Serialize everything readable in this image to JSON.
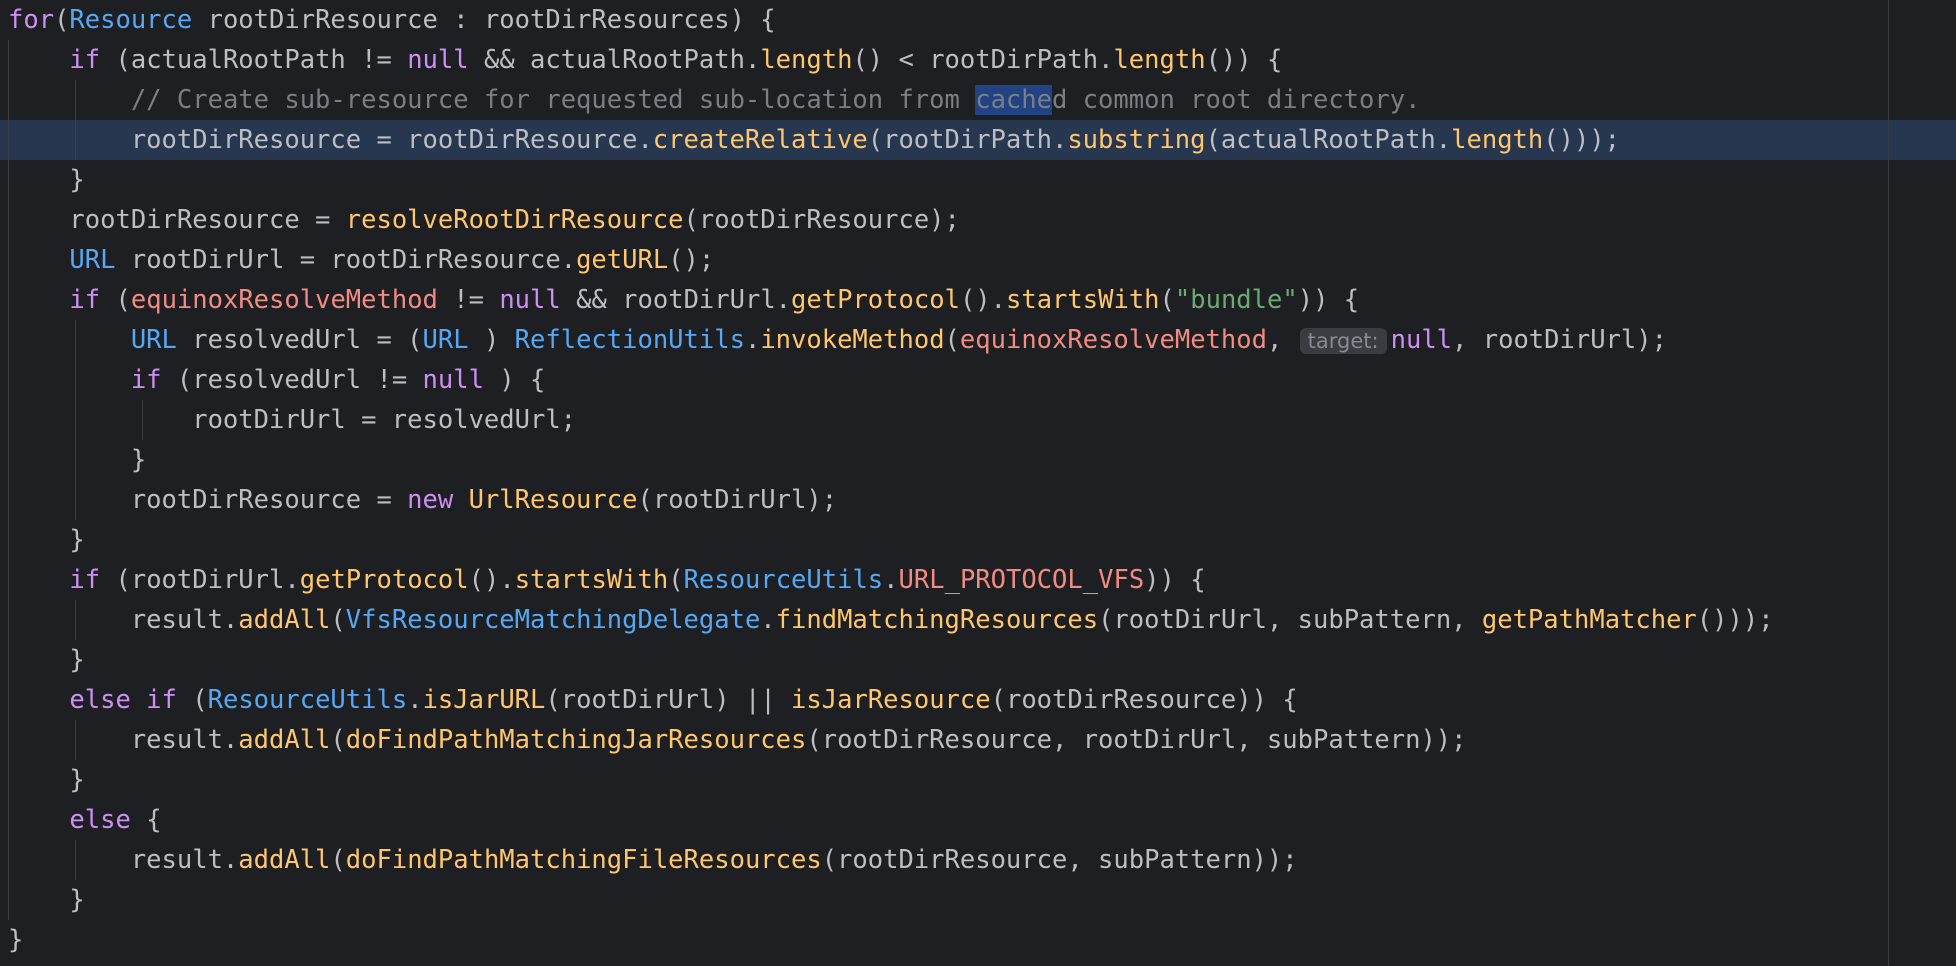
{
  "editor": {
    "colors": {
      "background": "#1e1f22",
      "default_text": "#bcbec4",
      "keyword": "#cf8ef4",
      "type": "#56a8f5",
      "method": "#ffc66d",
      "field": "#f28b82",
      "comment": "#7a7e85",
      "string": "#6aab73",
      "active_line": "#26374f",
      "search_highlight": "#214283"
    },
    "active_line_index": 3,
    "lines": [
      {
        "segments": [
          [
            "k",
            "for"
          ],
          [
            "",
            "("
          ],
          [
            "t",
            "Resource"
          ],
          [
            "",
            " rootDirResource : rootDirResources) {"
          ]
        ]
      },
      {
        "segments": [
          [
            "",
            "    "
          ],
          [
            "k",
            "if"
          ],
          [
            "",
            " (actualRootPath != "
          ],
          [
            "k",
            "null"
          ],
          [
            "",
            " && actualRootPath."
          ],
          [
            "m",
            "length"
          ],
          [
            "",
            "() < rootDirPath."
          ],
          [
            "m",
            "length"
          ],
          [
            "",
            "()) {"
          ]
        ]
      },
      {
        "segments": [
          [
            "",
            "        "
          ],
          [
            "cm",
            "// Create sub-resource for requested sub-location from "
          ],
          [
            "cm hl",
            "cache"
          ],
          [
            "cm",
            "d common root directory."
          ]
        ]
      },
      {
        "segments": [
          [
            "",
            "        rootDirResource = rootDirResource."
          ],
          [
            "m",
            "createRelative"
          ],
          [
            "",
            "(rootDirPath."
          ],
          [
            "m",
            "substring"
          ],
          [
            "",
            "(actualRootPath."
          ],
          [
            "m",
            "length"
          ],
          [
            "",
            "()));"
          ]
        ]
      },
      {
        "segments": [
          [
            "",
            "    }"
          ]
        ]
      },
      {
        "segments": [
          [
            "",
            "    rootDirResource = "
          ],
          [
            "m",
            "resolveRootDirResource"
          ],
          [
            "",
            "(rootDirResource);"
          ]
        ]
      },
      {
        "segments": [
          [
            "",
            "    "
          ],
          [
            "t",
            "URL"
          ],
          [
            "",
            " rootDirUrl = rootDirResource."
          ],
          [
            "m",
            "getURL"
          ],
          [
            "",
            "();"
          ]
        ]
      },
      {
        "segments": [
          [
            "",
            "    "
          ],
          [
            "k",
            "if"
          ],
          [
            "",
            " ("
          ],
          [
            "fld",
            "equinoxResolveMethod"
          ],
          [
            "",
            " != "
          ],
          [
            "k",
            "null"
          ],
          [
            "",
            " && rootDirUrl."
          ],
          [
            "m",
            "getProtocol"
          ],
          [
            "",
            "()."
          ],
          [
            "m",
            "startsWith"
          ],
          [
            "",
            "("
          ],
          [
            "str",
            "\"bundle\""
          ],
          [
            "",
            "))"
          ],
          [
            "",
            " {"
          ]
        ]
      },
      {
        "segments": [
          [
            "",
            "        "
          ],
          [
            "t",
            "URL"
          ],
          [
            "",
            " resolvedUrl = ("
          ],
          [
            "t",
            "URL"
          ],
          [
            "",
            " ) "
          ],
          [
            "t",
            "ReflectionUtils"
          ],
          [
            "",
            "."
          ],
          [
            "m",
            "invokeMethod"
          ],
          [
            "",
            "("
          ],
          [
            "fld",
            "equinoxResolveMethod"
          ],
          [
            "",
            ", "
          ],
          [
            "hint",
            "target:"
          ],
          [
            "k",
            "null"
          ],
          [
            "",
            ", rootDirUrl);"
          ]
        ]
      },
      {
        "segments": [
          [
            "",
            "        "
          ],
          [
            "k",
            "if"
          ],
          [
            "",
            " (resolvedUrl != "
          ],
          [
            "k",
            "null"
          ],
          [
            "",
            " ) {"
          ]
        ]
      },
      {
        "segments": [
          [
            "",
            "            rootDirUrl = resolvedUrl;"
          ]
        ]
      },
      {
        "segments": [
          [
            "",
            "        }"
          ]
        ]
      },
      {
        "segments": [
          [
            "",
            "        rootDirResource = "
          ],
          [
            "k",
            "new"
          ],
          [
            "",
            " "
          ],
          [
            "m",
            "UrlResource"
          ],
          [
            "",
            "(rootDirUrl);"
          ]
        ]
      },
      {
        "segments": [
          [
            "",
            "    }"
          ]
        ]
      },
      {
        "segments": [
          [
            "",
            "    "
          ],
          [
            "k",
            "if"
          ],
          [
            "",
            " (rootDirUrl."
          ],
          [
            "m",
            "getProtocol"
          ],
          [
            "",
            "()."
          ],
          [
            "m",
            "startsWith"
          ],
          [
            "",
            "("
          ],
          [
            "t",
            "ResourceUtils"
          ],
          [
            "",
            "."
          ],
          [
            "fld",
            "URL_PROTOCOL_VFS"
          ],
          [
            "",
            ")) {"
          ]
        ]
      },
      {
        "segments": [
          [
            "",
            "        result."
          ],
          [
            "m",
            "addAll"
          ],
          [
            "",
            "("
          ],
          [
            "t",
            "VfsResourceMatchingDelegate"
          ],
          [
            "",
            "."
          ],
          [
            "m",
            "findMatchingResources"
          ],
          [
            "",
            "(rootDirUrl, subPattern, "
          ],
          [
            "m",
            "getPathMatcher"
          ],
          [
            "",
            "()));"
          ]
        ]
      },
      {
        "segments": [
          [
            "",
            "    }"
          ]
        ]
      },
      {
        "segments": [
          [
            "",
            "    "
          ],
          [
            "k",
            "else if"
          ],
          [
            "",
            " ("
          ],
          [
            "t",
            "ResourceUtils"
          ],
          [
            "",
            "."
          ],
          [
            "m",
            "isJarURL"
          ],
          [
            "",
            "(rootDirUrl) || "
          ],
          [
            "m",
            "isJarResource"
          ],
          [
            "",
            "(rootDirResource)) {"
          ]
        ]
      },
      {
        "segments": [
          [
            "",
            "        result."
          ],
          [
            "m",
            "addAll"
          ],
          [
            "",
            "("
          ],
          [
            "m",
            "doFindPathMatchingJarResources"
          ],
          [
            "",
            "(rootDirResource, rootDirUrl, subPattern));"
          ]
        ]
      },
      {
        "segments": [
          [
            "",
            "    }"
          ]
        ]
      },
      {
        "segments": [
          [
            "",
            "    "
          ],
          [
            "k",
            "else"
          ],
          [
            "",
            " {"
          ]
        ]
      },
      {
        "segments": [
          [
            "",
            "        result."
          ],
          [
            "m",
            "addAll"
          ],
          [
            "",
            "("
          ],
          [
            "m",
            "doFindPathMatchingFileResources"
          ],
          [
            "",
            "(rootDirResource, subPattern));"
          ]
        ]
      },
      {
        "segments": [
          [
            "",
            "    }"
          ]
        ]
      },
      {
        "segments": [
          [
            "",
            "}"
          ]
        ]
      }
    ]
  }
}
